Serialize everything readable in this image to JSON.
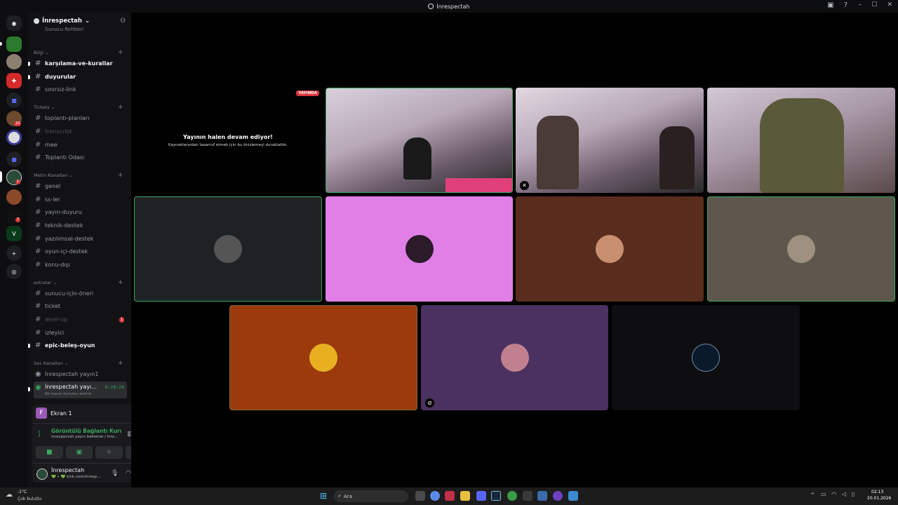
{
  "window": {
    "title": "İnrespectah"
  },
  "server": {
    "name": "İnrespectah",
    "partial_top": "Sunucu Rehberi"
  },
  "categories": {
    "bilgi": "Bilgi",
    "tickets": "Tickets",
    "metin": "Metin Kanalları",
    "extralar": "extralar",
    "ses": "Ses Kanalları"
  },
  "channels": {
    "karsilama": "karşılama-ve-kurallar",
    "duyurular": "duyurular",
    "sinirsiz": "sınırsız-link",
    "toplanti_planlari": "toplantı-planları",
    "transcript": "transcript",
    "mee": "mee",
    "toplanti_odasi": "Toplantı Odası",
    "genel": "genel",
    "ssler": "ss-ler",
    "yayin_duyuru": "yayın-duyuru",
    "teknik": "teknik-destek",
    "yazilimsal": "yazılımsal-destek",
    "oyun_ici": "oyun-içi-destek",
    "konu_disi": "konu-dışı",
    "sunucu_oneri": "sunucu-için-öneri",
    "ticket": "ticket",
    "level_up": "level-up",
    "izleyici": "izleyici",
    "epic": "epic-beleş-oyun",
    "voice1": "İnrespectah yayın1",
    "voice2": "İnrespectah yayı...",
    "voice2_timer": "6:28:24",
    "voice2_status": "Bir kanal durumu belirle",
    "levelup_badge": "1"
  },
  "guild_badges": {
    "b1": "10",
    "b2": "1",
    "b3": "7"
  },
  "stream_panel": {
    "avatar_letter": "F",
    "name": "Ekran 1"
  },
  "connection": {
    "status": "Görüntülü Bağlantı Kuruldu",
    "detail": "İnrespectah yayın beklerse / İnre..."
  },
  "user": {
    "name": "İnrespectah",
    "status": "💚 • 💚 kick.com/inresp..."
  },
  "stream_tile": {
    "live_badge": "YAYINDA",
    "title": "Yayının halen devam ediyor!",
    "subtitle": "Kaynaklarından tasarruf etmek için bu önizlemeyi duraklattık."
  },
  "taskbar": {
    "weather_temp": "-1°C",
    "weather_desc": "Çok bulutlu",
    "search": "Ara",
    "time": "02:13",
    "date": "20.01.2026"
  },
  "colors": {
    "speaking": "#3ba55c",
    "tile_pink": "#e080e6",
    "tile_brown": "#5a2c1e",
    "tile_taupe": "#5e574d",
    "tile_orange": "#9c3a0e",
    "tile_purple": "#4a3160",
    "accent_green": "#3ba55c"
  }
}
